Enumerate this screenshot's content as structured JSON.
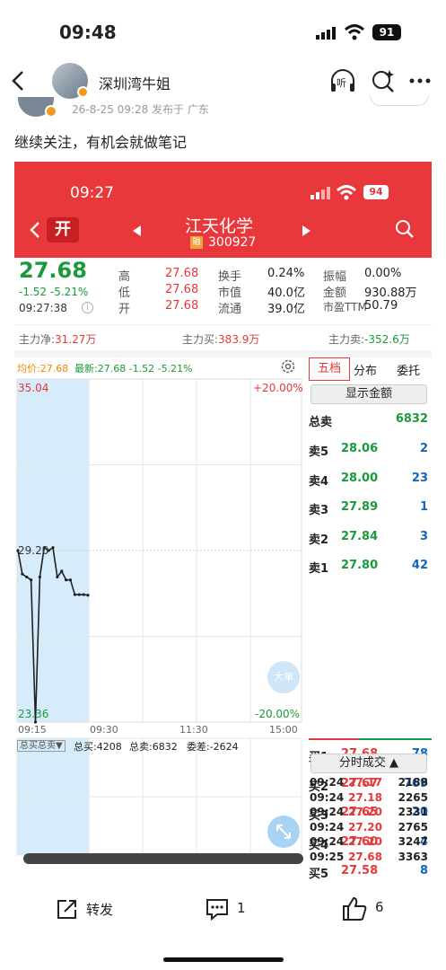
{
  "status": {
    "time": "09:48",
    "battery": "91"
  },
  "header": {
    "title": "深圳湾牛姐",
    "listen_label": "听"
  },
  "post": {
    "meta": "26-8-25 09:28  发布于 广东",
    "text": "继续关注，有机会就做笔记"
  },
  "stock": {
    "status_time": "09:27",
    "battery": "94",
    "open_badge": "开",
    "name": "江天化学",
    "tag": "融",
    "code": "300927",
    "price": "27.68",
    "change": "-1.52 -5.21%",
    "timestamp": "09:27:38",
    "stats": [
      {
        "label": "高",
        "value": "27.68",
        "label2": "换手",
        "value2": "0.24%",
        "label3": "振幅",
        "value3": "0.00%"
      },
      {
        "label": "低",
        "value": "27.68",
        "label2": "市值",
        "value2": "40.0亿",
        "label3": "金额",
        "value3": "930.88万"
      },
      {
        "label": "开",
        "value": "27.68",
        "label2": "流通",
        "value2": "39.0亿",
        "label3": "市盈TTM",
        "value3": "50.79"
      }
    ],
    "flows": {
      "net_label": "主力净:",
      "net_value": "31.27万",
      "buy_label": "主力买:",
      "buy_value": "383.9万",
      "sell_label": "主力卖:",
      "sell_value": "-352.6万"
    }
  },
  "chart_header": {
    "avg": "均价:27.68",
    "latest": "最新:27.68 -1.52 -5.21%"
  },
  "tabs": [
    "五档",
    "分布",
    "委托"
  ],
  "show_amount": "显示金额",
  "order_book": {
    "total_sell_label": "总卖",
    "total_sell": "6832",
    "asks": [
      {
        "label": "卖5",
        "price": "28.06",
        "qty": "2"
      },
      {
        "label": "卖4",
        "price": "28.00",
        "qty": "23"
      },
      {
        "label": "卖3",
        "price": "27.89",
        "qty": "1"
      },
      {
        "label": "卖2",
        "price": "27.84",
        "qty": "3"
      },
      {
        "label": "卖1",
        "price": "27.80",
        "qty": "42"
      }
    ],
    "bids": [
      {
        "label": "买1",
        "price": "27.68",
        "qty": "78"
      },
      {
        "label": "买2",
        "price": "27.67",
        "qty": "769"
      },
      {
        "label": "买3",
        "price": "27.65",
        "qty": "20"
      },
      {
        "label": "买4",
        "price": "27.60",
        "qty": "4"
      },
      {
        "label": "买5",
        "price": "27.58",
        "qty": "8"
      }
    ],
    "total_buy_label": "总买",
    "total_buy": "4208"
  },
  "ticks_header": "分时成交 ▲",
  "ticks": [
    {
      "time": "09:24",
      "price": "27.17",
      "vol": "2188"
    },
    {
      "time": "09:24",
      "price": "27.18",
      "vol": "2265"
    },
    {
      "time": "09:24",
      "price": "27.20",
      "vol": "2331"
    },
    {
      "time": "09:24",
      "price": "27.20",
      "vol": "2765"
    },
    {
      "time": "09:24",
      "price": "27.20",
      "vol": "3247"
    },
    {
      "time": "09:25",
      "price": "27.68",
      "vol": "3363"
    }
  ],
  "volume_bar": {
    "dropdown": "总买总卖▼",
    "buy": "总买:4208",
    "sell": "总卖:6832",
    "diff": "委差:-2624"
  },
  "big_order_label": "大单",
  "actions": {
    "share": "转发",
    "comments": "1",
    "likes": "6"
  },
  "chart_data": {
    "type": "line",
    "y_top_label": "35.04",
    "y_bottom_label": "23.36",
    "y_mid_label": "29.20",
    "pct_top": "+20.00%",
    "pct_bottom": "-20.00%",
    "x_labels": [
      "09:15",
      "09:30",
      "11:30",
      "15:00"
    ],
    "ylim": [
      23.36,
      35.04
    ],
    "series": [
      {
        "values": [
          29.2,
          28.4,
          28.3,
          28.2,
          23.36,
          28.3,
          29.3,
          29.2,
          29.3,
          28.3,
          28.5,
          28.2,
          28.2,
          27.7,
          27.7,
          27.7,
          27.68
        ]
      }
    ]
  },
  "colors": {
    "brand_red": "#e8383b",
    "up": "#e5393b",
    "down": "#1a9a3a",
    "accent_orange": "#f08a00"
  }
}
